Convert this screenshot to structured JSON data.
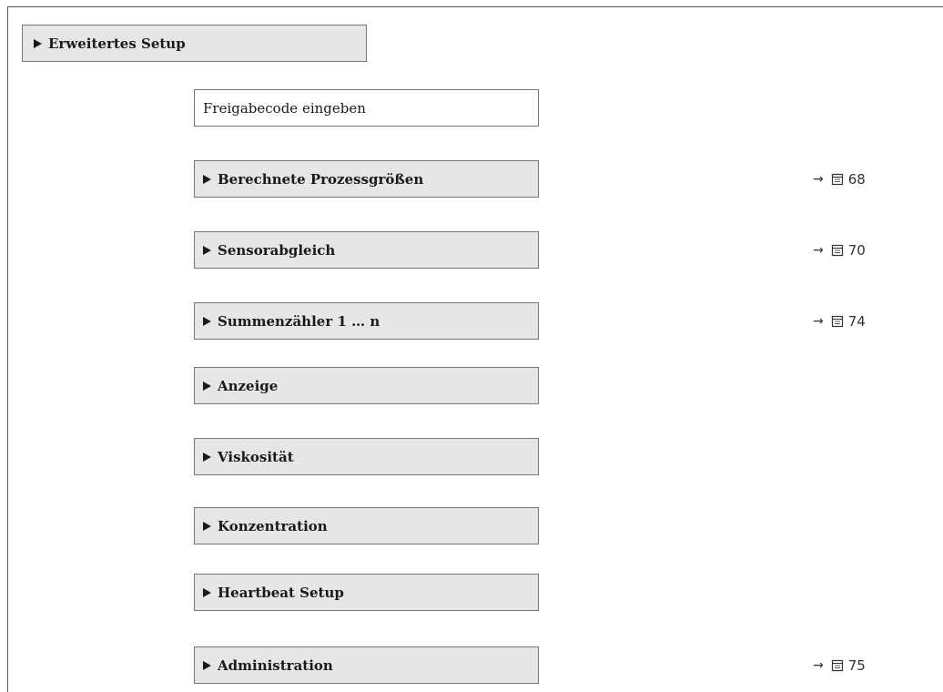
{
  "header": {
    "label": "Erweitertes Setup"
  },
  "items": [
    {
      "label": "Freigabecode eingeben",
      "kind": "parameter",
      "page_ref": null
    },
    {
      "label": "Berechnete Prozessgrößen",
      "kind": "submenu",
      "page_ref": "68"
    },
    {
      "label": "Sensorabgleich",
      "kind": "submenu",
      "page_ref": "70"
    },
    {
      "label": "Summenzähler 1 … n",
      "kind": "submenu",
      "page_ref": "74"
    },
    {
      "label": "Anzeige",
      "kind": "submenu",
      "page_ref": null
    },
    {
      "label": "Viskosität",
      "kind": "submenu",
      "page_ref": null
    },
    {
      "label": "Konzentration",
      "kind": "submenu",
      "page_ref": null
    },
    {
      "label": "Heartbeat Setup",
      "kind": "submenu",
      "page_ref": null
    },
    {
      "label": "Administration",
      "kind": "submenu",
      "page_ref": "75"
    }
  ],
  "colors": {
    "submenu_fill": "#e6e6e6",
    "border": "#777777",
    "frame": "#555555"
  },
  "icons": {
    "expand": "triangle-right-icon",
    "reference": "arrow-right-icon",
    "page": "book-icon"
  }
}
